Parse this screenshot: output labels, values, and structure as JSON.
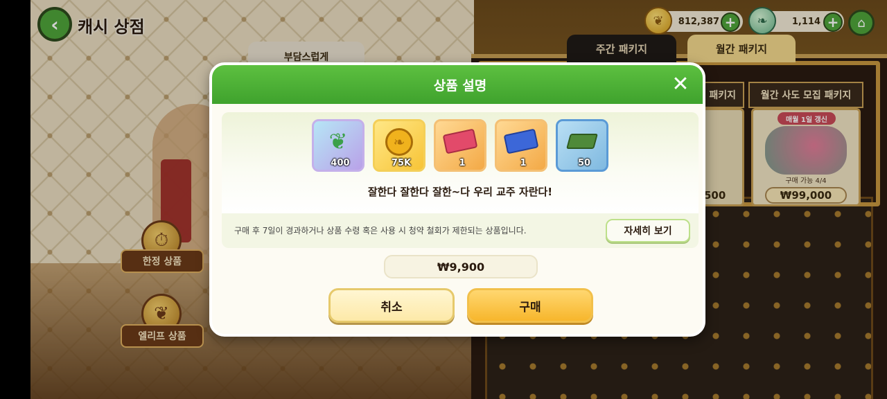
{
  "top_bar": {
    "title": "캐시 상점",
    "coins": "812,387",
    "crystals": "1,114"
  },
  "background": {
    "label_top": "부담스럽게",
    "tabs": [
      "주간 패키지",
      "월간 패키지"
    ],
    "partial_package": {
      "title": "패키지",
      "price": "500"
    },
    "package": {
      "title": "월간 사도 모집 패키지",
      "badge": "매월 1일 갱신",
      "limit": "구매 가능 4/4",
      "price": "₩99,000"
    },
    "shelf_labels": [
      "한정 상품",
      "엘리프 상품"
    ]
  },
  "modal": {
    "title": "상품 설명",
    "items": [
      {
        "icon": "leaf-crystal-icon",
        "qty": "400"
      },
      {
        "icon": "coin-icon",
        "qty": "75K"
      },
      {
        "icon": "red-ticket-icon",
        "qty": "1"
      },
      {
        "icon": "blue-ticket-icon",
        "qty": "1"
      },
      {
        "icon": "book-icon",
        "qty": "50"
      }
    ],
    "tagline": "잘한다 잘한다 잘한~다 우리 교주 자란다!",
    "notice": "구매 후 7일이 경과하거나 상품 수령 혹은 사용 시 청약 철회가 제한되는 상품입니다.",
    "detail_label": "자세히 보기",
    "price": "₩9,900",
    "cancel_label": "취소",
    "buy_label": "구매"
  }
}
